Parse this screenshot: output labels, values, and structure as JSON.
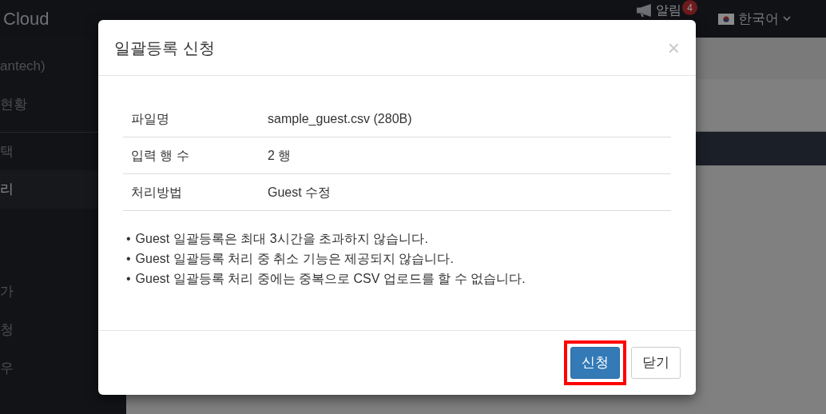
{
  "header": {
    "brand": "Cloud",
    "notifications": {
      "label": "알림",
      "count": "4"
    },
    "language": "한국어"
  },
  "sidebar": {
    "items": [
      {
        "label": "antech)",
        "selected": false
      },
      {
        "label": "현황",
        "selected": false
      },
      {
        "label": "택",
        "selected": false
      },
      {
        "label": "리",
        "selected": true
      },
      {
        "label": "가",
        "selected": false
      },
      {
        "label": "청",
        "selected": false
      },
      {
        "label": "우",
        "selected": false
      }
    ]
  },
  "dialog": {
    "title": "일괄등록 신청",
    "close": "×",
    "rows": [
      {
        "label": "파일명",
        "value": "sample_guest.csv (280B)"
      },
      {
        "label": "입력 행 수",
        "value": "2 행"
      },
      {
        "label": "처리방법",
        "value": "Guest 수정"
      }
    ],
    "notes": [
      {
        "bullet": "•",
        "text": "Guest 일괄등록은 최대 3시간을 초과하지 않습니다."
      },
      {
        "bullet": "•",
        "text": "Guest 일괄등록 처리 중 취소 기능은 제공되지 않습니다."
      },
      {
        "bullet": "•",
        "text": "Guest 일괄등록 처리 중에는 중복으로 CSV 업로드를 할 수 없습니다."
      }
    ],
    "buttons": [
      {
        "label": "신청",
        "kind": "primary",
        "highlighted": true
      },
      {
        "label": "닫기",
        "kind": "default",
        "highlighted": false
      }
    ]
  }
}
